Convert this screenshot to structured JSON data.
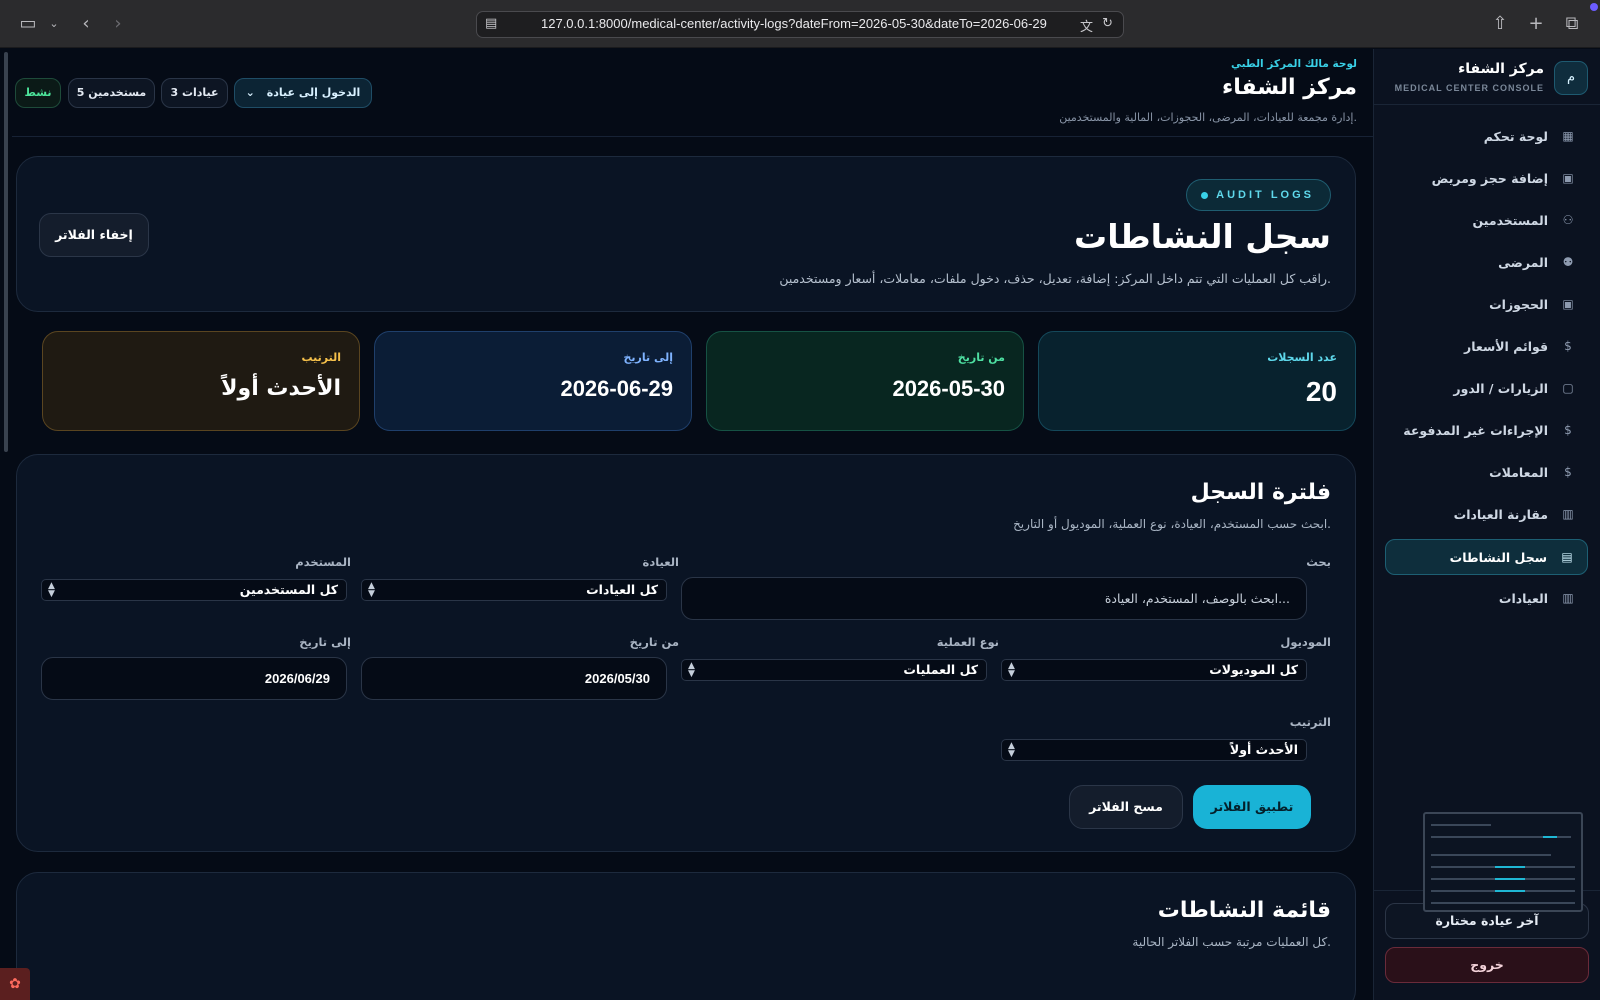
{
  "browser": {
    "url": "127.0.0.1:8000/medical-center/activity-logs?dateFrom=2026-05-30&dateTo=2026-06-29"
  },
  "sidebar": {
    "brand_name": "مركز الشفاء",
    "brand_sub": "MEDICAL CENTER CONSOLE",
    "logo_letter": "م",
    "items": [
      {
        "label": "لوحة تحكم",
        "icon": "dashboard-icon"
      },
      {
        "label": "إضافة حجز ومريض",
        "icon": "calendar-icon"
      },
      {
        "label": "المستخدمين",
        "icon": "users-icon"
      },
      {
        "label": "المرضى",
        "icon": "patients-icon"
      },
      {
        "label": "الحجوزات",
        "icon": "calendar-icon"
      },
      {
        "label": "قوائم الأسعار",
        "icon": "dollar-icon"
      },
      {
        "label": "الزيارات / الدور",
        "icon": "queue-icon"
      },
      {
        "label": "الإجراءات غير المدفوعة",
        "icon": "dollar-icon"
      },
      {
        "label": "المعاملات",
        "icon": "dollar-icon"
      },
      {
        "label": "مقارنة العيادات",
        "icon": "chart-icon"
      },
      {
        "label": "سجل النشاطات",
        "icon": "document-icon",
        "active": true
      },
      {
        "label": "العيادات",
        "icon": "building-icon"
      }
    ],
    "last_clinic": "آخر عيادة مختارة",
    "logout": "خروج"
  },
  "topbar": {
    "kicker": "لوحة مالك المركز الطبي",
    "title": "مركز الشفاء",
    "subtitle": "إدارة مجمعة للعيادات، المرضى، الحجوزات، المالية والمستخدمين.",
    "enter_clinic": "الدخول إلى عيادة",
    "clinics_count": "عيادات 3",
    "users_count": "مستخدمين 5",
    "status": "نشط"
  },
  "hero": {
    "badge": "AUDIT LOGS",
    "title": "سجل النشاطات",
    "description": "راقب كل العمليات التي تتم داخل المركز: إضافة، تعديل، حذف، دخول ملفات، معاملات، أسعار ومستخدمين.",
    "hide_filters": "إخفاء الفلاتر"
  },
  "stats": {
    "records_label": "عدد السجلات",
    "records_value": "20",
    "from_label": "من تاريخ",
    "from_value": "2026-05-30",
    "to_label": "إلى تاريخ",
    "to_value": "2026-06-29",
    "order_label": "الترتيب",
    "order_value": "الأحدث أولاً"
  },
  "filters": {
    "title": "فلترة السجل",
    "subtitle": "ابحث حسب المستخدم، العيادة، نوع العملية، الموديول أو التاريخ.",
    "search_label": "بحث",
    "search_placeholder": "ابحث بالوصف، المستخدم، العيادة...",
    "clinic_label": "العيادة",
    "clinic_value": "كل العيادات",
    "user_label": "المستخدم",
    "user_value": "كل المستخدمين",
    "module_label": "الموديول",
    "module_value": "كل الموديولات",
    "action_label": "نوع العملية",
    "action_value": "كل العمليات",
    "from_label": "من تاريخ",
    "from_value": "2026/05/30",
    "to_label": "إلى تاريخ",
    "to_value": "2026/06/29",
    "order_label": "الترتيب",
    "order_value": "الأحدث أولاً",
    "apply": "تطبيق الفلاتر",
    "clear": "مسح الفلاتر"
  },
  "list": {
    "title": "قائمة النشاطات",
    "subtitle": "كل العمليات مرتبة حسب الفلاتر الحالية."
  }
}
